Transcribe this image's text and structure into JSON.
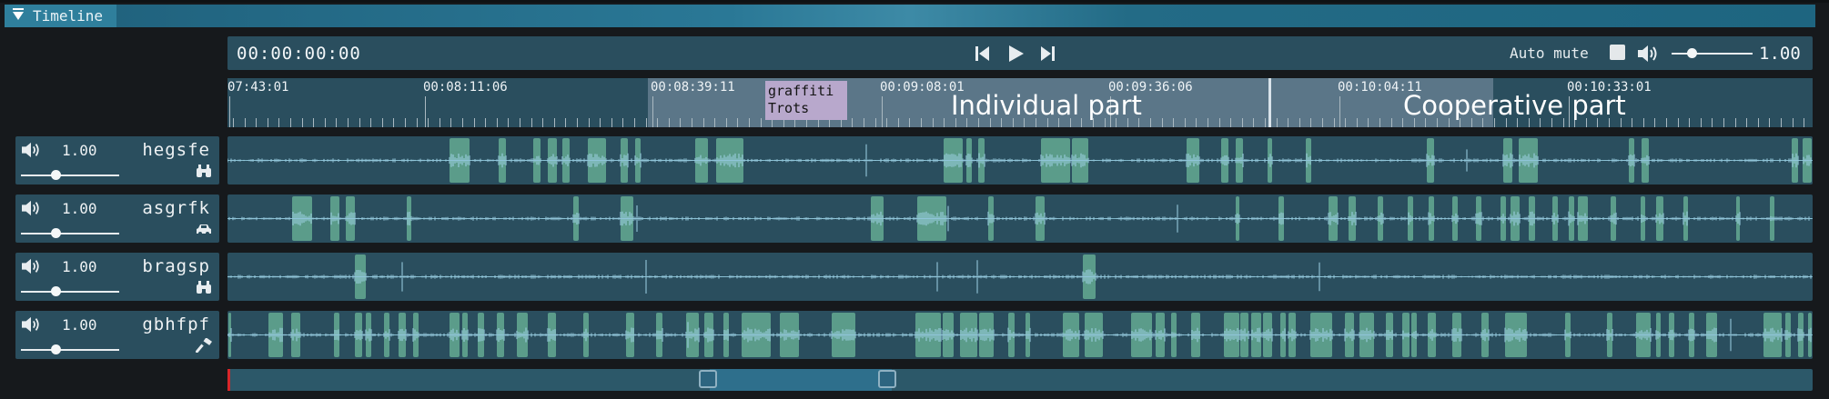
{
  "panel": {
    "title": "Timeline"
  },
  "transport": {
    "timecode": "00:00:00:00",
    "auto_mute_label": "Auto mute",
    "master_volume": "1.00",
    "master_volume_level": 0.25
  },
  "ruler": {
    "tick_labels": [
      "07:43:01",
      "00:08:11:06",
      "00:08:39:11",
      "00:09:08:01",
      "00:09:36:06",
      "00:10:04:11",
      "00:10:33:01"
    ],
    "annotation": {
      "line1": "graffiti",
      "line2": "Trots"
    },
    "regions": [
      {
        "label": "Individual part"
      },
      {
        "label": "Cooperative part"
      }
    ]
  },
  "tracks": [
    {
      "name": "hegsfe",
      "volume": "1.00",
      "volume_level": 0.25,
      "icon": "binoculars-icon"
    },
    {
      "name": "asgrfk",
      "volume": "1.00",
      "volume_level": 0.25,
      "icon": "car-icon"
    },
    {
      "name": "bragsp",
      "volume": "1.00",
      "volume_level": 0.25,
      "icon": "binoculars-icon"
    },
    {
      "name": "gbhfpf",
      "volume": "1.00",
      "volume_level": 0.25,
      "icon": "hammer-icon"
    }
  ],
  "colors": {
    "panel": "#2a4e5e",
    "segment": "#5fa38e",
    "waveform": "#9fd2e6",
    "region": "#a0afc3",
    "annotation": "#b8a8cc",
    "playhead": "#d7262a"
  }
}
